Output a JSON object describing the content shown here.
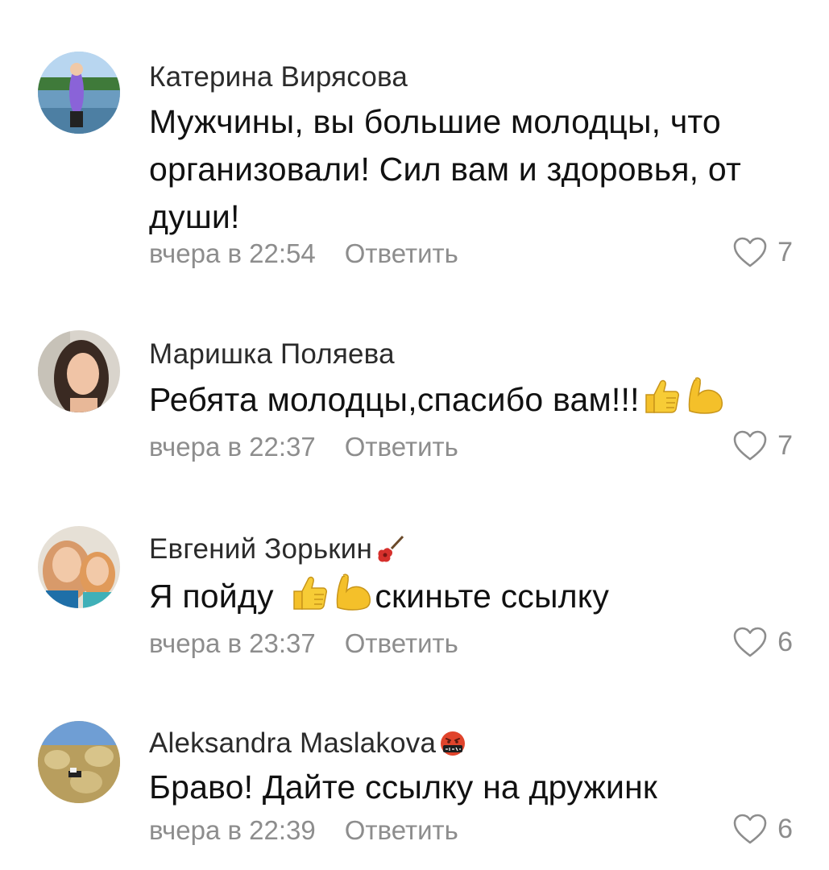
{
  "comments": [
    {
      "author": "Катерина Вирясова",
      "text": "Мужчины, вы большие молодцы, что организовали! Сил вам и здоровья, от души!",
      "time": "вчера в 22:54",
      "reply_label": "Ответить",
      "likes": "7"
    },
    {
      "author": "Маришка Поляева",
      "text": "Ребята молодцы,спасибо вам!!!",
      "time": "вчера в 22:37",
      "reply_label": "Ответить",
      "likes": "7",
      "text_emojis": [
        "thumbs-up-emoji",
        "flexed-biceps-emoji"
      ]
    },
    {
      "author": "Евгений Зорькин",
      "author_emoji": "guitar-emoji",
      "text_before": "Я пойду",
      "text_after": "скиньте ссылку",
      "time": "вчера в 23:37",
      "reply_label": "Ответить",
      "likes": "6",
      "text_emojis": [
        "thumbs-up-emoji",
        "flexed-biceps-emoji"
      ]
    },
    {
      "author": "Aleksandra Maslakova",
      "author_emoji": "face-with-symbols-emoji",
      "text": "Браво! Дайте ссылку на дружинк",
      "time": "вчера в 22:39",
      "reply_label": "Ответить",
      "likes": "6"
    }
  ],
  "icons": {
    "like": "heart-outline-icon"
  },
  "colors": {
    "meta_text": "#8d8d8d",
    "author_text": "#2b2b2b",
    "emoji_yellow": "#f4c02a"
  }
}
